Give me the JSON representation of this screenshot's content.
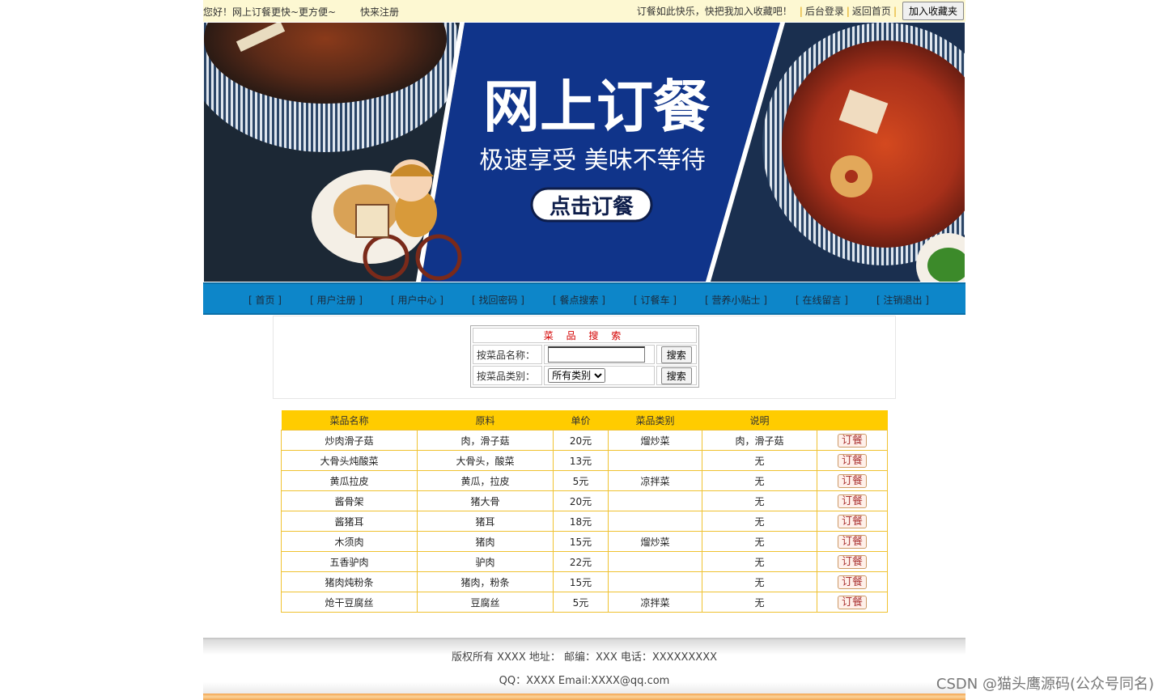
{
  "topbar": {
    "greeting": "您好！网上订餐更快~更方便~",
    "register": "快来注册",
    "slogan": "订餐如此快乐，快把我加入收藏吧！",
    "admin_login": "后台登录",
    "home": "返回首页",
    "add_favorite": "加入收藏夹"
  },
  "banner": {
    "title": "网上订餐",
    "subtitle": "极速享受 美味不等待",
    "cta": "点击订餐"
  },
  "nav": [
    "[ 首页 ]",
    "[ 用户注册 ]",
    "[ 用户中心 ]",
    "[ 找回密码 ]",
    "[ 餐点搜索 ]",
    "[ 订餐车 ]",
    "[ 营养小贴士 ]",
    "[ 在线留言 ]",
    "[ 注销退出 ]"
  ],
  "search": {
    "title": "菜 品 搜 索",
    "name_label": "按菜品名称：",
    "name_value": "",
    "category_label": "按菜品类别：",
    "category_selected": "所有类别",
    "button": "搜索"
  },
  "menu_table": {
    "headers": [
      "菜品名称",
      "原料",
      "单价",
      "菜品类别",
      "说明",
      ""
    ],
    "order_label": "订餐",
    "rows": [
      [
        "炒肉滑子菇",
        "肉，滑子菇",
        "20元",
        "熘炒菜",
        "肉，滑子菇"
      ],
      [
        "大骨头炖酸菜",
        "大骨头，酸菜",
        "13元",
        "",
        "无"
      ],
      [
        "黄瓜拉皮",
        "黄瓜，拉皮",
        "5元",
        "凉拌菜",
        "无"
      ],
      [
        "酱骨架",
        "猪大骨",
        "20元",
        "",
        "无"
      ],
      [
        "酱猪耳",
        "猪耳",
        "18元",
        "",
        "无"
      ],
      [
        "木须肉",
        "猪肉",
        "15元",
        "熘炒菜",
        "无"
      ],
      [
        "五香驴肉",
        "驴肉",
        "22元",
        "",
        "无"
      ],
      [
        "猪肉炖粉条",
        "猪肉，粉条",
        "15元",
        "",
        "无"
      ],
      [
        "炝干豆腐丝",
        "豆腐丝",
        "5元",
        "凉拌菜",
        "无"
      ]
    ]
  },
  "footer": {
    "line1": "版权所有 XXXX 地址：  邮编：XXX 电话：XXXXXXXXX",
    "line2": "QQ：XXXX  Email:XXXX@qq.com"
  },
  "watermark": "CSDN @猫头鹰源码(公众号同名)",
  "colors": {
    "nav_bg": "#0d86c9",
    "banner_panel": "#10348a",
    "table_header": "#ffcc00",
    "topbar_bg": "#fdf8d2"
  }
}
